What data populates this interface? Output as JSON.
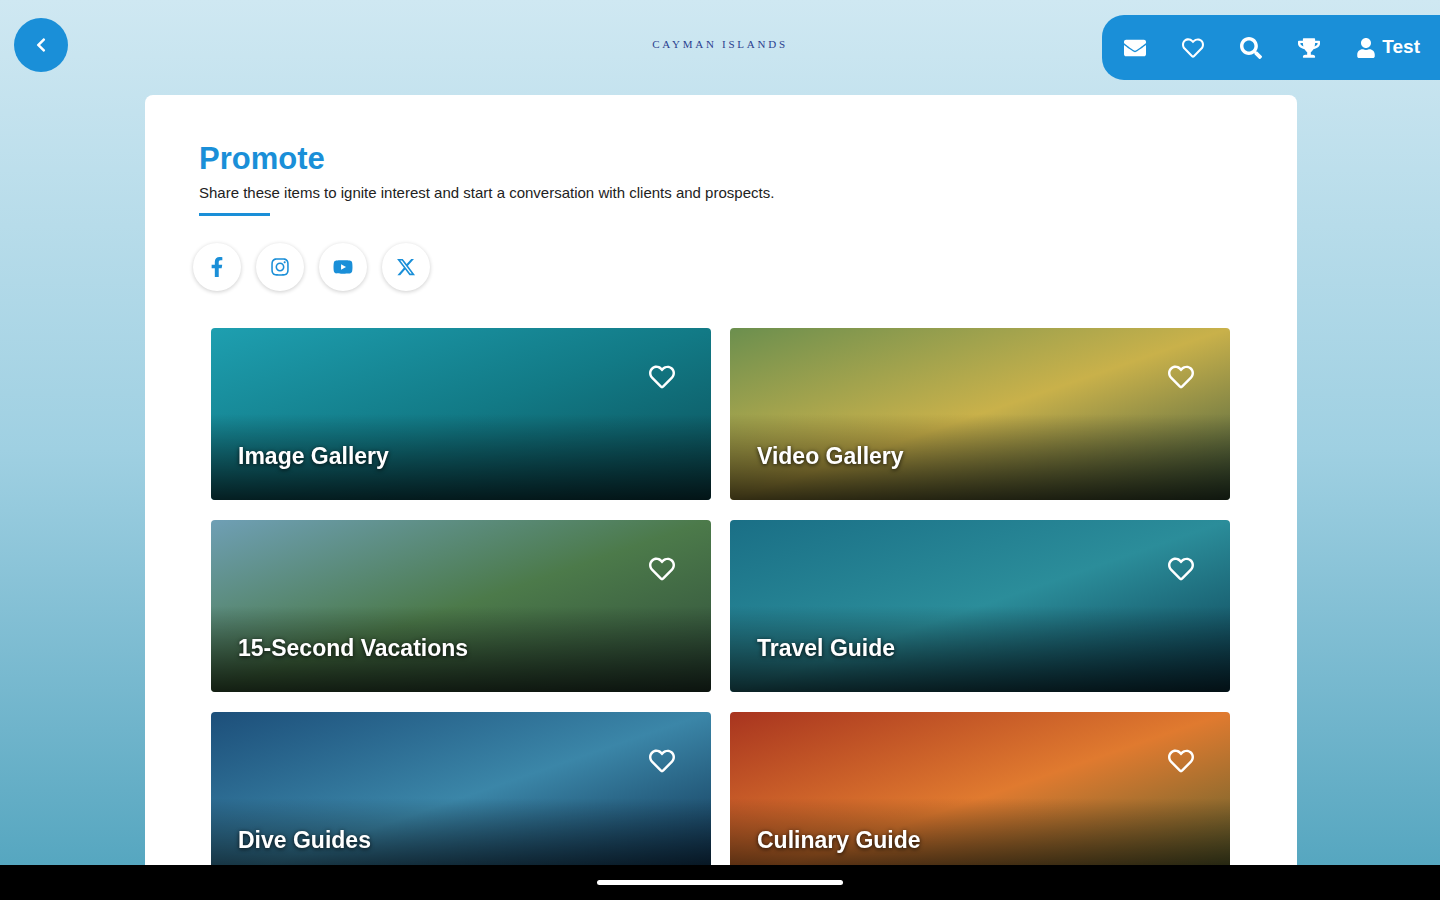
{
  "logo": {
    "text": "CAYMAN ISLANDS"
  },
  "toolbar": {
    "items": [
      {
        "kind": "mail"
      },
      {
        "kind": "favorites"
      },
      {
        "kind": "search"
      },
      {
        "kind": "trophy"
      }
    ],
    "user": {
      "label": "Test"
    }
  },
  "page": {
    "title": "Promote",
    "subtitle": "Share these items to ignite interest and start a conversation with clients and prospects."
  },
  "social": [
    {
      "kind": "facebook"
    },
    {
      "kind": "instagram"
    },
    {
      "kind": "youtube"
    },
    {
      "kind": "x"
    }
  ],
  "tiles": [
    {
      "title": "Image Gallery",
      "favorite": false
    },
    {
      "title": "Video Gallery",
      "favorite": false
    },
    {
      "title": "15-Second Vacations",
      "favorite": false
    },
    {
      "title": "Travel Guide",
      "favorite": false
    },
    {
      "title": "Dive Guides",
      "favorite": false
    },
    {
      "title": "Culinary Guide",
      "favorite": false
    }
  ]
}
